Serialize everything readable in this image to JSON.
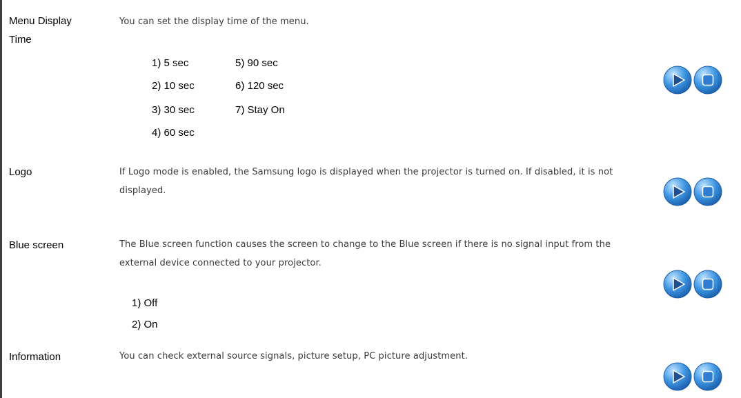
{
  "sections": [
    {
      "term": "Menu Display Time",
      "description": "You can set the display time of the menu.",
      "options": [
        "1) 5 sec",
        "2) 10 sec",
        "3) 30 sec",
        "4) 60 sec",
        "5) 90 sec",
        "6) 120 sec",
        "7) Stay On"
      ]
    },
    {
      "term": "Logo",
      "description": "If Logo mode is enabled, the Samsung logo is displayed when the projector is turned on. If disabled, it is not displayed."
    },
    {
      "term": "Blue screen",
      "description": "The Blue screen function causes the screen to change to the Blue screen if there is no signal input from the external device connected to your projector.",
      "options": [
        "1) Off",
        "2) On"
      ]
    },
    {
      "term": "Information",
      "description": "You can check external source signals, picture setup, PC picture adjustment."
    }
  ],
  "controls": {
    "play_icon": "play-icon",
    "stop_icon": "stop-icon",
    "colors": {
      "button_blue": "#2f86d6",
      "button_highlight": "#bfe3ff"
    }
  }
}
